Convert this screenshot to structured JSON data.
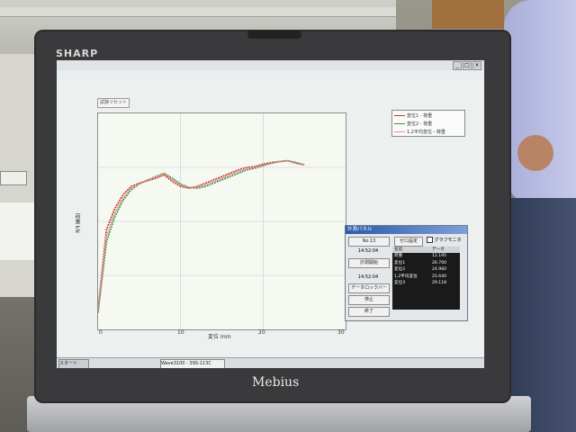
{
  "laptop": {
    "brand": "SHARP",
    "model": "Mebius"
  },
  "window": {
    "title_button": "試験リセット"
  },
  "chart_data": {
    "type": "line",
    "xlabel": "変位 mm",
    "ylabel": "荷重 kN",
    "xlim": [
      0,
      30
    ],
    "x_ticks": [
      "0",
      "10",
      "20",
      "30"
    ],
    "series": [
      {
        "name": "変位1 - 荷重",
        "color": "#c0392b",
        "x": [
          0,
          1,
          2,
          3,
          4,
          5,
          6,
          7,
          8,
          9,
          10,
          11,
          12,
          13,
          14,
          15,
          16,
          17,
          18,
          19,
          20,
          21,
          22,
          23,
          24,
          25
        ],
        "y": [
          25,
          120,
          145,
          162,
          172,
          176,
          179,
          182,
          186,
          178,
          172,
          170,
          172,
          176,
          180,
          184,
          188,
          192,
          195,
          196,
          199,
          201,
          202,
          203,
          200,
          198
        ]
      },
      {
        "name": "変位2 - 荷重",
        "color": "#2c9c3b",
        "x": [
          0,
          1,
          2,
          3,
          4,
          5,
          6,
          7,
          8,
          9,
          10,
          11,
          12,
          13,
          14,
          15,
          16,
          17,
          18,
          19,
          20,
          21,
          22,
          23,
          24,
          25
        ],
        "y": [
          20,
          105,
          135,
          155,
          168,
          175,
          180,
          184,
          188,
          182,
          175,
          171,
          170,
          172,
          176,
          180,
          184,
          188,
          192,
          194,
          197,
          200,
          202,
          203,
          201,
          198
        ]
      },
      {
        "name": "1,2平均変位 - 荷重",
        "color": "#e98a99",
        "x": [
          0,
          1,
          2,
          3,
          4,
          5,
          6,
          7,
          8,
          9,
          10,
          11,
          12,
          13,
          14,
          15,
          16,
          17,
          18,
          19,
          20,
          21,
          22,
          23,
          24,
          25
        ],
        "y": [
          22,
          112,
          140,
          158,
          170,
          175,
          180,
          183,
          187,
          180,
          173,
          170,
          171,
          174,
          178,
          182,
          186,
          190,
          193,
          195,
          198,
          200,
          202,
          203,
          200,
          198
        ]
      }
    ]
  },
  "calc_panel": {
    "title": "計測パネル",
    "no_label": "No.13",
    "init_button": "ゼロ設定",
    "check_label": "グラフモニタ",
    "time1": "14:52:04",
    "start_button": "計測開始",
    "time2": "14:52:04",
    "data_button": "データロックバー",
    "stop_button": "停止",
    "exit_button": "終了",
    "table_header": [
      "名前",
      "データ"
    ],
    "table_rows": [
      [
        "荷重",
        "12.195"
      ],
      [
        "変位1",
        "26.700"
      ],
      [
        "変位2",
        "24.960"
      ],
      [
        "1,2平均変位",
        "25.640"
      ],
      [
        "変位3",
        "29.118"
      ]
    ]
  },
  "taskbar": {
    "start": "スタート",
    "app": "Wave3100 - 39S-113C"
  }
}
